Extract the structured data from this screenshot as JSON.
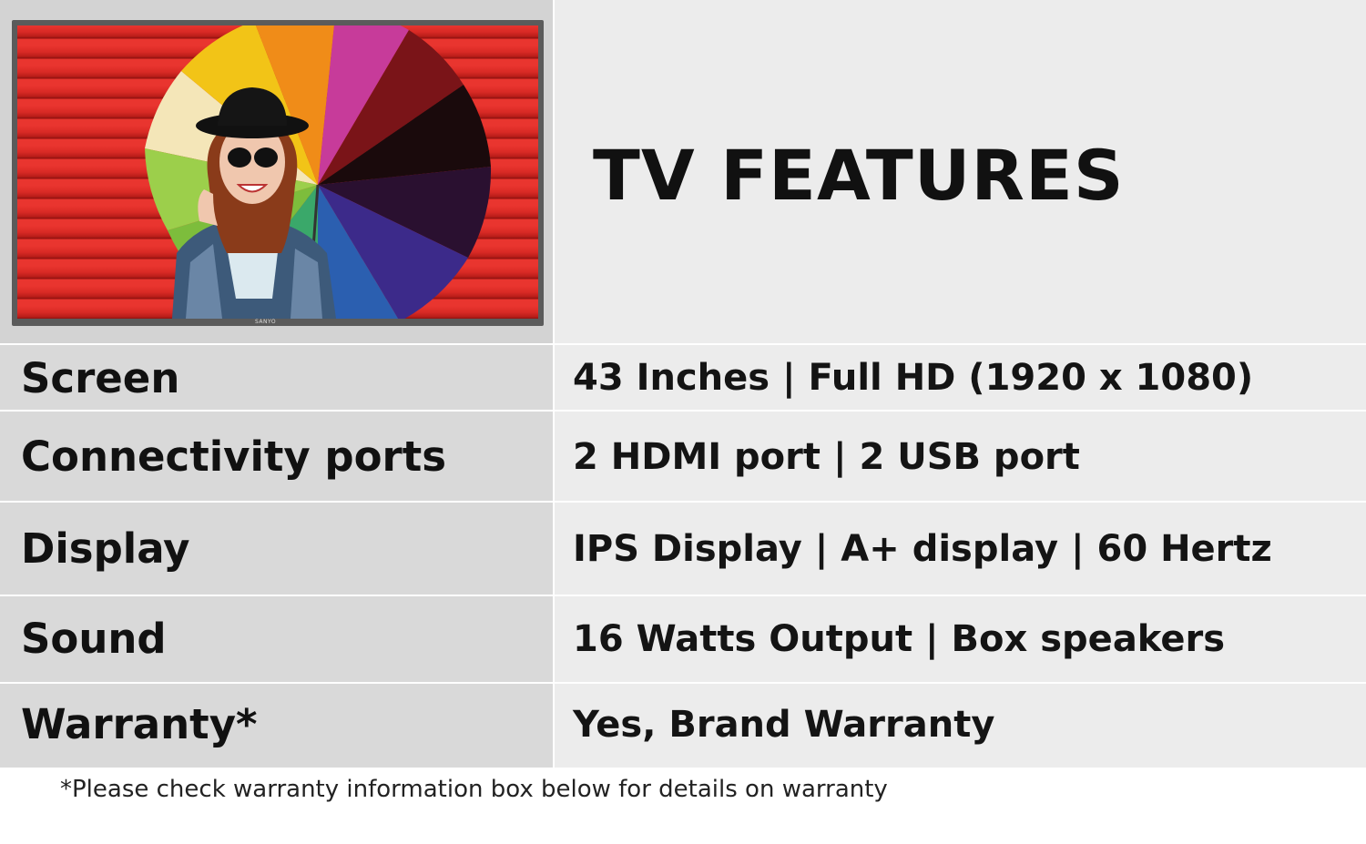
{
  "header": {
    "title": "TV FEATURES",
    "tv_brand": "SANYO"
  },
  "features": [
    {
      "label": "Screen",
      "value": "43 Inches  |  Full HD (1920 x 1080)"
    },
    {
      "label": "Connectivity ports",
      "value": "2 HDMI port  |  2 USB port"
    },
    {
      "label": "Display",
      "value": "IPS Display  |  A+ display  |  60 Hertz"
    },
    {
      "label": "Sound",
      "value": "16 Watts Output  |  Box speakers"
    },
    {
      "label": "Warranty*",
      "value": "Yes, Brand Warranty"
    }
  ],
  "footnote": "*Please check warranty information box below for details on warranty",
  "colors": {
    "label_bg": "#d9d9d9",
    "value_bg": "#ececec",
    "wall_red": "#d92a25"
  }
}
